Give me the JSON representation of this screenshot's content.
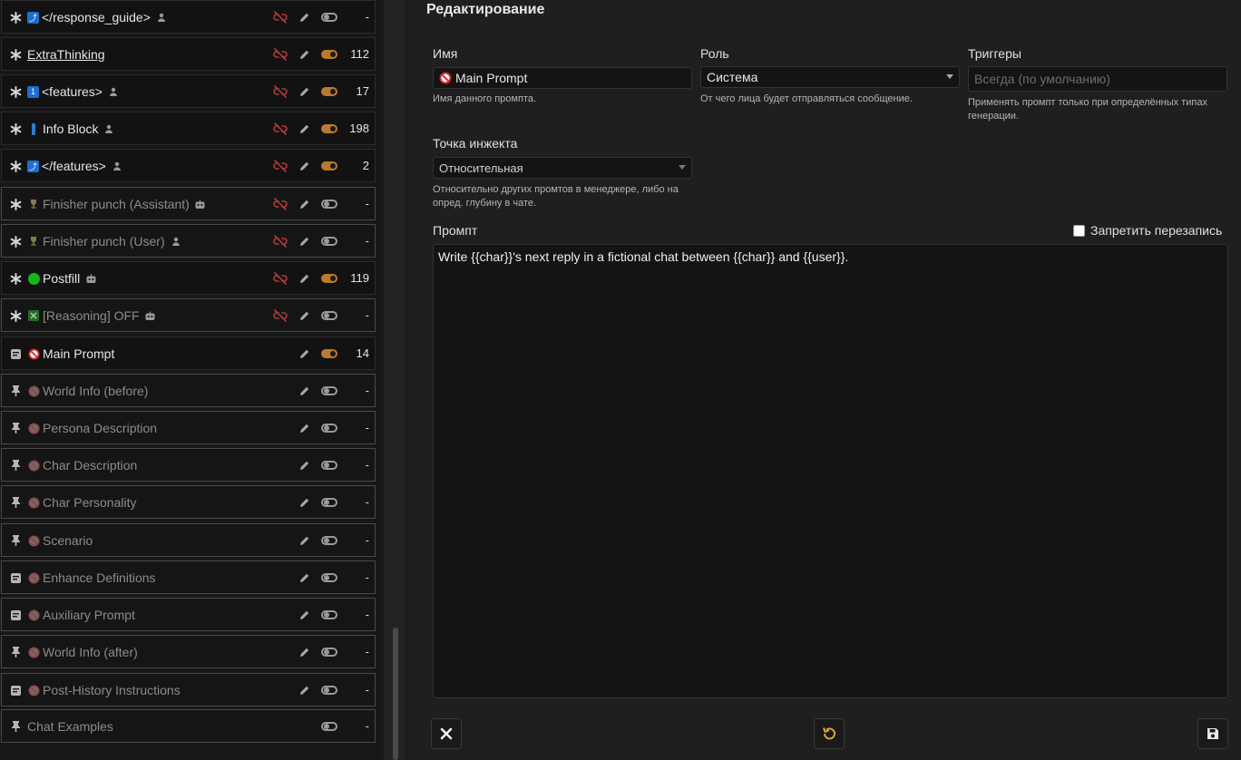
{
  "prompt_list": {
    "items": [
      {
        "lead": "asterisk",
        "icon": "tag-blue",
        "tag_text": "⤴",
        "label": "</response_guide>",
        "role": "user",
        "enabled": false,
        "locked": true,
        "tokens": "-",
        "disabled": false
      },
      {
        "lead": "asterisk",
        "icon": "",
        "label": "ExtraThinking",
        "underline": true,
        "role": "",
        "enabled": true,
        "locked": true,
        "tokens": "112",
        "disabled": false
      },
      {
        "lead": "asterisk",
        "icon": "tag-blue",
        "tag_text": "1",
        "label": "<features>",
        "role": "user",
        "enabled": true,
        "locked": true,
        "tokens": "17",
        "disabled": false
      },
      {
        "lead": "asterisk",
        "icon": "bar-blue",
        "label": "Info Block",
        "role": "user",
        "enabled": true,
        "locked": true,
        "tokens": "198",
        "disabled": false
      },
      {
        "lead": "asterisk",
        "icon": "tag-blue",
        "tag_text": "⤴",
        "label": "</features>",
        "role": "user",
        "enabled": true,
        "locked": true,
        "tokens": "2",
        "disabled": false
      },
      {
        "lead": "asterisk",
        "icon": "trophy",
        "label": "Finisher punch (Assistant)",
        "role": "bot",
        "enabled": false,
        "locked": true,
        "tokens": "-",
        "disabled": true
      },
      {
        "lead": "asterisk",
        "icon": "trophy",
        "label": "Finisher punch (User)",
        "role": "user",
        "enabled": false,
        "locked": true,
        "tokens": "-",
        "disabled": true
      },
      {
        "lead": "asterisk",
        "icon": "green-circle",
        "label": "Postfill",
        "role": "bot",
        "enabled": true,
        "locked": true,
        "tokens": "119",
        "disabled": false
      },
      {
        "lead": "asterisk",
        "icon": "green-x",
        "label": "[Reasoning] OFF",
        "role": "bot",
        "enabled": false,
        "locked": true,
        "tokens": "-",
        "disabled": true
      },
      {
        "lead": "doc",
        "icon": "no",
        "label": "Main Prompt",
        "role": "",
        "enabled": true,
        "locked": false,
        "tokens": "14",
        "disabled": false
      },
      {
        "lead": "pin",
        "icon": "no",
        "label": "World Info (before)",
        "role": "",
        "enabled": false,
        "locked": false,
        "tokens": "-",
        "disabled": true
      },
      {
        "lead": "pin",
        "icon": "no",
        "label": "Persona Description",
        "role": "",
        "enabled": false,
        "locked": false,
        "tokens": "-",
        "disabled": true
      },
      {
        "lead": "pin",
        "icon": "no",
        "label": "Char Description",
        "role": "",
        "enabled": false,
        "locked": false,
        "tokens": "-",
        "disabled": true
      },
      {
        "lead": "pin",
        "icon": "no",
        "label": "Char Personality",
        "role": "",
        "enabled": false,
        "locked": false,
        "tokens": "-",
        "disabled": true
      },
      {
        "lead": "pin",
        "icon": "no",
        "label": "Scenario",
        "role": "",
        "enabled": false,
        "locked": false,
        "tokens": "-",
        "disabled": true
      },
      {
        "lead": "doc",
        "icon": "no",
        "label": "Enhance Definitions",
        "role": "",
        "enabled": false,
        "locked": false,
        "tokens": "-",
        "disabled": true
      },
      {
        "lead": "doc",
        "icon": "no",
        "label": "Auxiliary Prompt",
        "role": "",
        "enabled": false,
        "locked": false,
        "tokens": "-",
        "disabled": true
      },
      {
        "lead": "pin",
        "icon": "no",
        "label": "World Info (after)",
        "role": "",
        "enabled": false,
        "locked": false,
        "tokens": "-",
        "disabled": true
      },
      {
        "lead": "doc",
        "icon": "no",
        "label": "Post-History Instructions",
        "role": "",
        "enabled": false,
        "locked": false,
        "tokens": "-",
        "disabled": true
      },
      {
        "lead": "pin",
        "icon": "",
        "label": "Chat Examples",
        "role": "",
        "enabled": false,
        "locked": false,
        "no_pencil": true,
        "tokens": "-",
        "disabled": true
      }
    ]
  },
  "editor": {
    "title": "Редактирование",
    "name_label": "Имя",
    "name_value": "Main Prompt",
    "name_hint": "Имя данного промпта.",
    "role_label": "Роль",
    "role_value": "Система",
    "role_hint": "От чего лица будет отправляться сообщение.",
    "triggers_label": "Триггеры",
    "triggers_placeholder": "Всегда (по умолчанию)",
    "triggers_hint": "Применять промпт только при определённых типах генерации.",
    "injection_label": "Точка инжекта",
    "injection_value": "Относительная",
    "injection_hint": "Относительно других промтов в менеджере, либо на опред. глубину в чате.",
    "prompt_label": "Промпт",
    "forbid_overrides_label": "Запретить перезапись",
    "prompt_text": "Write {{char}}'s next reply in a fictional chat between {{char}} and {{user}}."
  },
  "colors": {
    "accent_toggle": "#b87a2e",
    "unlink_red": "#b03a3a"
  }
}
